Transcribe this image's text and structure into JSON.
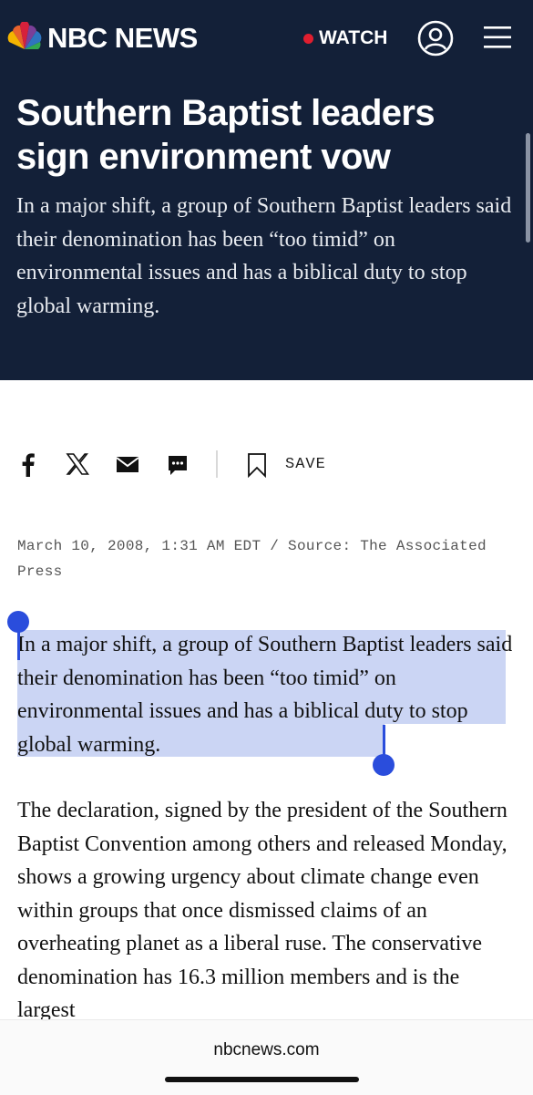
{
  "header": {
    "brand": "NBC NEWS",
    "watch_label": "WATCH",
    "icons": [
      "peacock-logo-icon",
      "account-icon",
      "menu-icon"
    ],
    "colors": {
      "background": "#132038",
      "live_dot": "#e01e2f"
    }
  },
  "article": {
    "headline": "Southern Baptist leaders sign environment vow",
    "dek": "In a major shift, a group of Southern Baptist leaders said their denomination has been “too timid” on environmental issues and has a biblical duty to stop global warming.",
    "dateline": "March 10, 2008, 1:31 AM EDT / Source: The Associated Press",
    "paragraphs": [
      "In a major shift, a group of Southern Baptist leaders said their denomination has been “too timid” on environmental issues and has a biblical duty to stop global warming.",
      "The declaration, signed by the president of the Southern Baptist Convention among others and released Monday, shows a growing urgency about climate change even within groups that once dismissed claims of an overheating planet as a liberal ruse. The conservative denomination has 16.3 million members and is the largest"
    ]
  },
  "share": {
    "icons": [
      "facebook-icon",
      "x-icon",
      "email-icon",
      "sms-icon",
      "bookmark-icon"
    ],
    "save_label": "SAVE"
  },
  "browser": {
    "url": "nbcnews.com",
    "selection_color": "#cbd5f4",
    "handle_color": "#2a4ddc"
  }
}
